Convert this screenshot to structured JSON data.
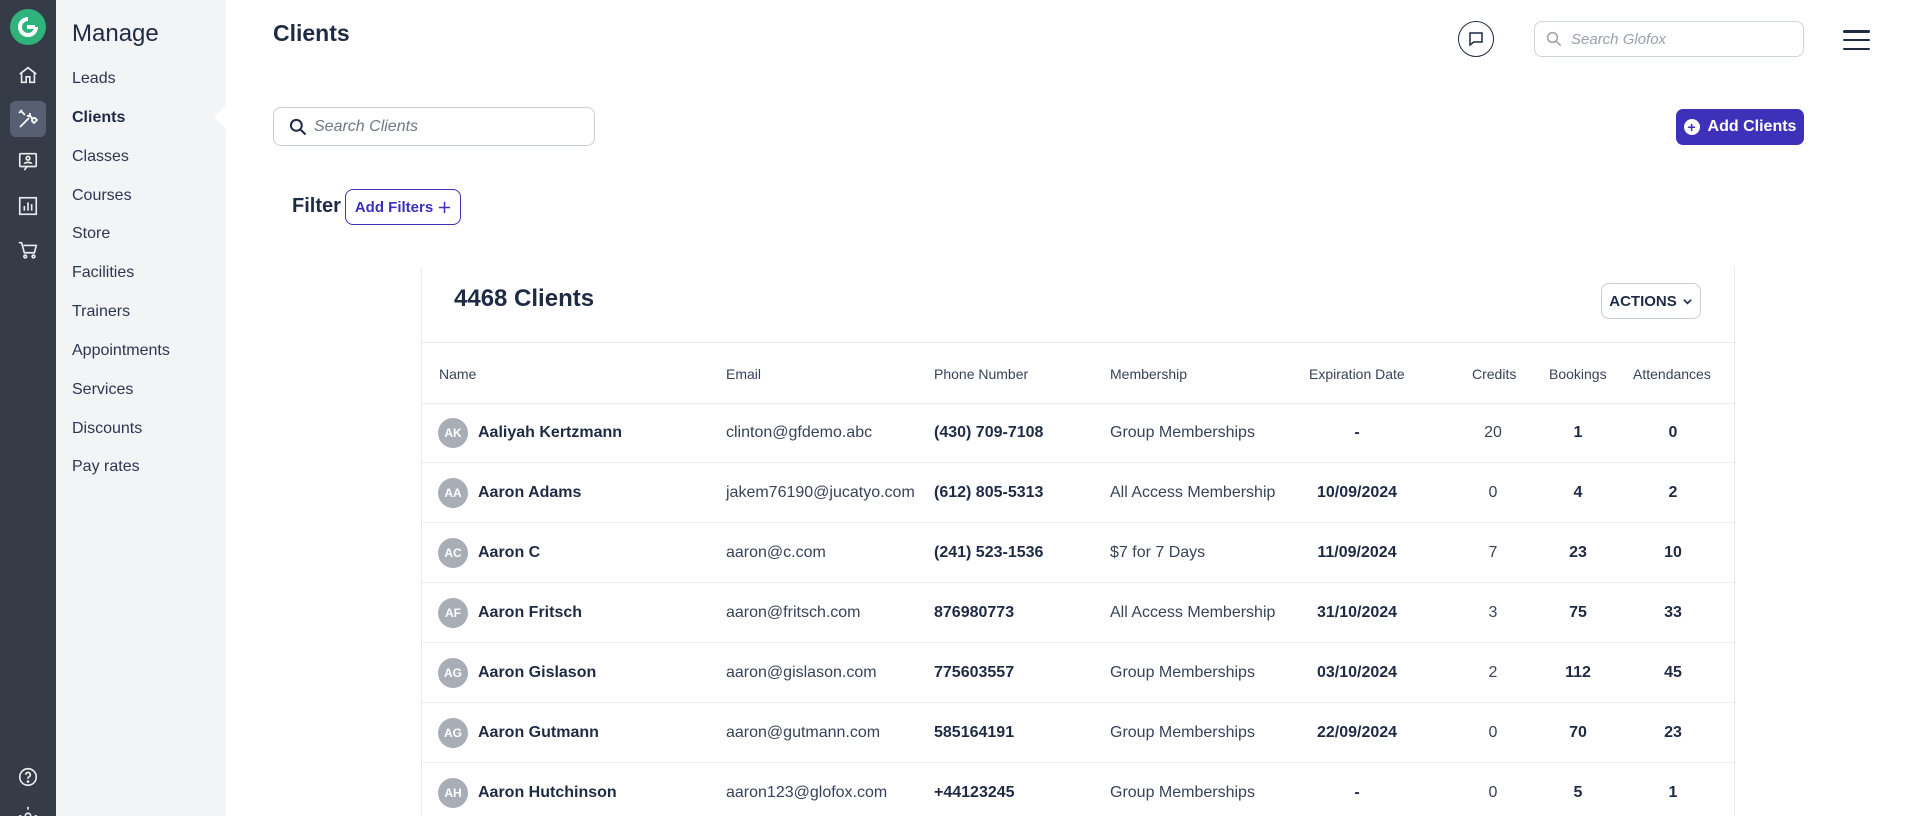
{
  "sidebar": {
    "title": "Manage",
    "items": [
      {
        "label": "Leads"
      },
      {
        "label": "Clients",
        "active": true
      },
      {
        "label": "Classes"
      },
      {
        "label": "Courses"
      },
      {
        "label": "Store"
      },
      {
        "label": "Facilities"
      },
      {
        "label": "Trainers"
      },
      {
        "label": "Appointments"
      },
      {
        "label": "Services"
      },
      {
        "label": "Discounts"
      },
      {
        "label": "Pay rates"
      }
    ]
  },
  "rail": {
    "icons": [
      "logo-icon",
      "home-icon",
      "manage-tools-icon",
      "messages-icon",
      "reports-icon",
      "store-cart-icon",
      "help-icon",
      "settings-icon"
    ],
    "active": "manage-tools-icon"
  },
  "header": {
    "title": "Clients",
    "global_search_placeholder": "Search Glofox"
  },
  "toolbar": {
    "client_search_placeholder": "Search Clients",
    "add_clients_label": "Add Clients"
  },
  "filter": {
    "label": "Filter",
    "add_filters_label": "Add Filters"
  },
  "table": {
    "count_label": "4468 Clients",
    "actions_label": "ACTIONS",
    "columns": [
      "Name",
      "Email",
      "Phone Number",
      "Membership",
      "Expiration Date",
      "Credits",
      "Bookings",
      "Attendances"
    ],
    "rows": [
      {
        "initials": "AK",
        "name": "Aaliyah Kertzmann",
        "email": "clinton@gfdemo.abc",
        "phone": "(430) 709-7108",
        "membership": "Group Memberships",
        "expiration": "-",
        "credits": "20",
        "bookings": "1",
        "attendances": "0"
      },
      {
        "initials": "AA",
        "name": "Aaron Adams",
        "email": "jakem76190@jucatyo.com",
        "phone": "(612) 805-5313",
        "membership": "All Access Membership",
        "expiration": "10/09/2024",
        "credits": "0",
        "bookings": "4",
        "attendances": "2"
      },
      {
        "initials": "AC",
        "name": "Aaron C",
        "email": "aaron@c.com",
        "phone": "(241) 523-1536",
        "membership": "$7 for 7 Days",
        "expiration": "11/09/2024",
        "credits": "7",
        "bookings": "23",
        "attendances": "10"
      },
      {
        "initials": "AF",
        "name": "Aaron Fritsch",
        "email": "aaron@fritsch.com",
        "phone": "876980773",
        "membership": "All Access Membership",
        "expiration": "31/10/2024",
        "credits": "3",
        "bookings": "75",
        "attendances": "33"
      },
      {
        "initials": "AG",
        "name": "Aaron Gislason",
        "email": "aaron@gislason.com",
        "phone": "775603557",
        "membership": "Group Memberships",
        "expiration": "03/10/2024",
        "credits": "2",
        "bookings": "112",
        "attendances": "45"
      },
      {
        "initials": "AG",
        "name": "Aaron Gutmann",
        "email": "aaron@gutmann.com",
        "phone": "585164191",
        "membership": "Group Memberships",
        "expiration": "22/09/2024",
        "credits": "0",
        "bookings": "70",
        "attendances": "23"
      },
      {
        "initials": "AH",
        "name": "Aaron Hutchinson",
        "email": "aaron123@glofox.com",
        "phone": "+44123245",
        "membership": "Group Memberships",
        "expiration": "-",
        "credits": "0",
        "bookings": "5",
        "attendances": "1"
      }
    ]
  },
  "colors": {
    "rail_bg": "#353c47",
    "sidebar_bg": "#f3f4f6",
    "accent": "#3c31b8",
    "brand_green": "#2fb37b",
    "text_dark": "#1f2a44"
  }
}
